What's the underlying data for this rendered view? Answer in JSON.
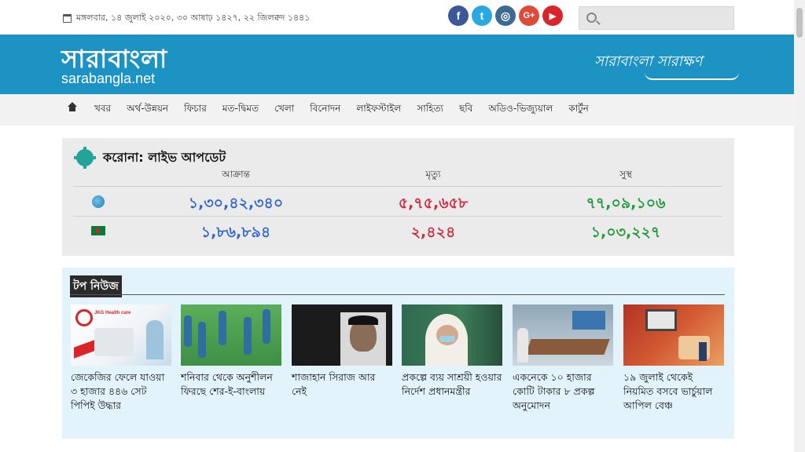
{
  "topbar": {
    "date": "মঙ্গলবার, ১৪ জুলাই ২০২০, ৩০ আষাঢ় ১৪২৭, ২২ জিলক্বদ ১৪৪১",
    "socials": [
      {
        "icon": "facebook-icon",
        "glyph": "f",
        "color": "#3b5998"
      },
      {
        "icon": "twitter-icon",
        "glyph": "t",
        "color": "#29a9e1"
      },
      {
        "icon": "instagram-icon",
        "glyph": "◎",
        "color": "#3d6a91"
      },
      {
        "icon": "google-plus-icon",
        "glyph": "G+",
        "color": "#dd4b39"
      },
      {
        "icon": "youtube-icon",
        "glyph": "▶",
        "color": "#d9252a"
      }
    ],
    "search_placeholder": ""
  },
  "brand": {
    "logo_bn": "সারাবাংলা",
    "logo_en": "sarabangla.net",
    "tagline": "সারাবাংলা সারাক্ষণ",
    "color": "#1d93c3"
  },
  "nav": {
    "items": [
      "খবর",
      "অর্থ-উন্নয়ন",
      "ফিচার",
      "মত-দ্বিমত",
      "খেলা",
      "বিনোদন",
      "লাইফস্টাইল",
      "সাহিত্য",
      "ছবি",
      "অডিও-ভিজ্যুয়াল",
      "কার্টুন"
    ]
  },
  "corona": {
    "title": "করোনা: লাইভ আপডেট",
    "headers": [
      "আক্রান্ত",
      "মৃত্যু",
      "সুস্থ"
    ],
    "world": [
      "১,৩০,৪২,৩৪০",
      "৫,৭৫,৬৫৮",
      "৭৭,০৯,১০৬"
    ],
    "bangladesh": [
      "১,৮৬,৮৯৪",
      "২,৪২৪",
      "১,০৩,২২৭"
    ]
  },
  "topnews": {
    "title": "টপ নিউজ",
    "cards": [
      {
        "headline": "জেকেজির ফেলে যাওয়া ৩ হাজার ৪৪৬ সেট পিপিই উদ্ধার",
        "thumb_text": "JKG Health care"
      },
      {
        "headline": "শনিবার থেকে অনুশীলন ফিরছে শের-ই-বাংলায়"
      },
      {
        "headline": "শাজাহান সিরাজ আর নেই"
      },
      {
        "headline": "প্রকল্পে ব্যয় সাশ্রয়ী হওয়ার নির্দেশ প্রধানমন্ত্রীর"
      },
      {
        "headline": "একনেকে ১০ হাজার কোটি টাকার ৮ প্রকল্প অনুমোদন"
      },
      {
        "headline": "১৯ জুলাই থেকেই নিয়মিত বসবে ভার্চুয়াল আপিল বেঞ্চ"
      }
    ]
  }
}
